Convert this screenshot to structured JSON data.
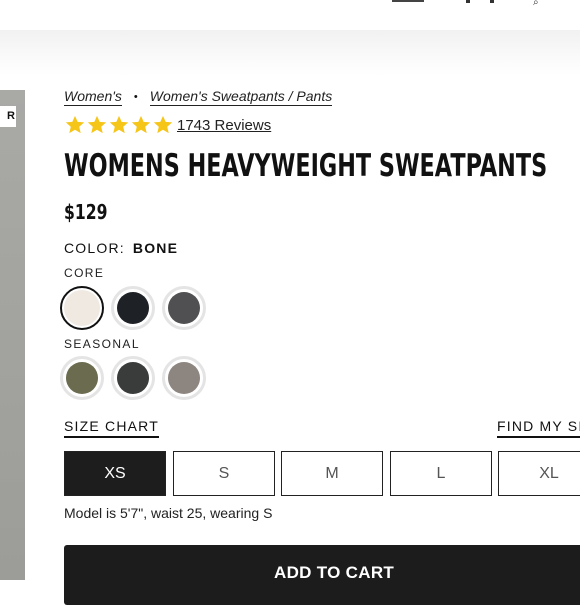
{
  "breadcrumb": [
    "Women's",
    "Women's Sweatpants / Pants"
  ],
  "breadcrumb_sep": "•",
  "image_badge": "R",
  "rating": {
    "stars": 5,
    "reviews_label": "1743 Reviews",
    "star_color": "#f5c518"
  },
  "product": {
    "title": "WOMENS HEAVYWEIGHT SWEATPANTS",
    "price": "$129"
  },
  "color": {
    "label": "COLOR:",
    "value": "BONE"
  },
  "swatch_groups": [
    {
      "label": "CORE",
      "swatches": [
        {
          "name": "bone",
          "color": "#efe9e2",
          "selected": true
        },
        {
          "name": "black",
          "color": "#1e2226",
          "selected": false
        },
        {
          "name": "charcoal",
          "color": "#505052",
          "selected": false
        }
      ]
    },
    {
      "label": "SEASONAL",
      "swatches": [
        {
          "name": "olive",
          "color": "#6b6b4f",
          "selected": false
        },
        {
          "name": "dark-grey",
          "color": "#3a3b3b",
          "selected": false
        },
        {
          "name": "taupe",
          "color": "#8d8580",
          "selected": false
        }
      ]
    }
  ],
  "size_chart_label": "SIZE CHART",
  "find_my_size_label": "FIND MY SI",
  "sizes": [
    {
      "label": "XS",
      "selected": true
    },
    {
      "label": "S",
      "selected": false
    },
    {
      "label": "M",
      "selected": false
    },
    {
      "label": "L",
      "selected": false
    },
    {
      "label": "XL",
      "selected": false
    }
  ],
  "model_note": "Model is 5'7\", waist 25, wearing S",
  "add_to_cart_label": "ADD TO CART"
}
